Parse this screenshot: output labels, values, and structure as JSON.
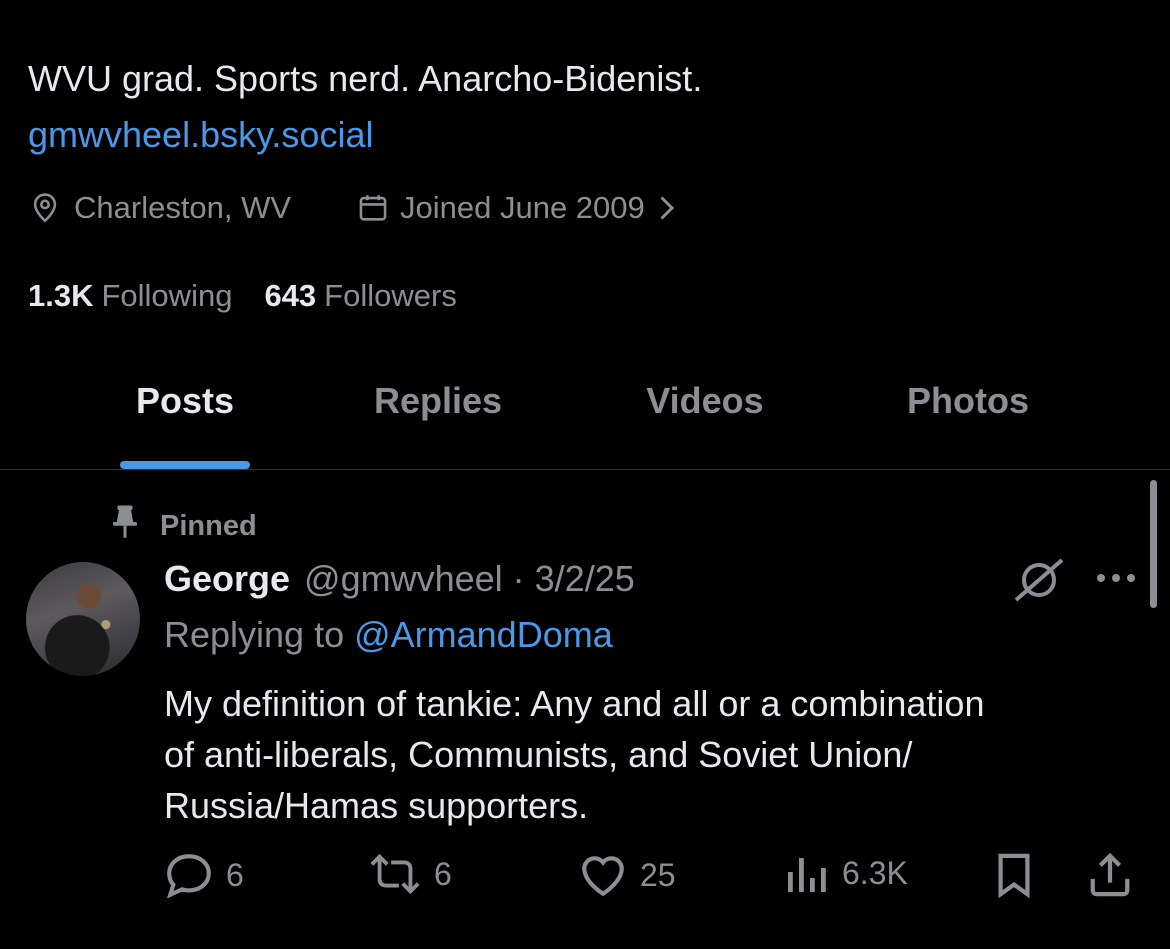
{
  "profile": {
    "bio": "WVU grad. Sports nerd. Anarcho-Bidenist.",
    "link": "gmwvheel.bsky.social",
    "location": "Charleston, WV",
    "joined": "Joined June 2009",
    "following_count": "1.3K",
    "following_label": "Following",
    "followers_count": "643",
    "followers_label": "Followers"
  },
  "tabs": [
    {
      "label": "Posts",
      "active": true
    },
    {
      "label": "Replies",
      "active": false
    },
    {
      "label": "Videos",
      "active": false
    },
    {
      "label": "Photos",
      "active": false
    }
  ],
  "post": {
    "pinned_label": "Pinned",
    "author_name": "George",
    "author_handle": "@gmwvheel · 3/2/25",
    "replying_prefix": "Replying to ",
    "replying_to": "@ArmandDoma",
    "text": "My definition of tankie: Any and all or a combination\nof anti-liberals, Communists, and Soviet Union/\nRussia/Hamas supporters.",
    "replies": "6",
    "reposts": "6",
    "likes": "25",
    "views": "6.3K"
  },
  "colors": {
    "background": "#000000",
    "text": "#e7e9ea",
    "muted": "#8b8f94",
    "accent": "#4a99e9"
  }
}
